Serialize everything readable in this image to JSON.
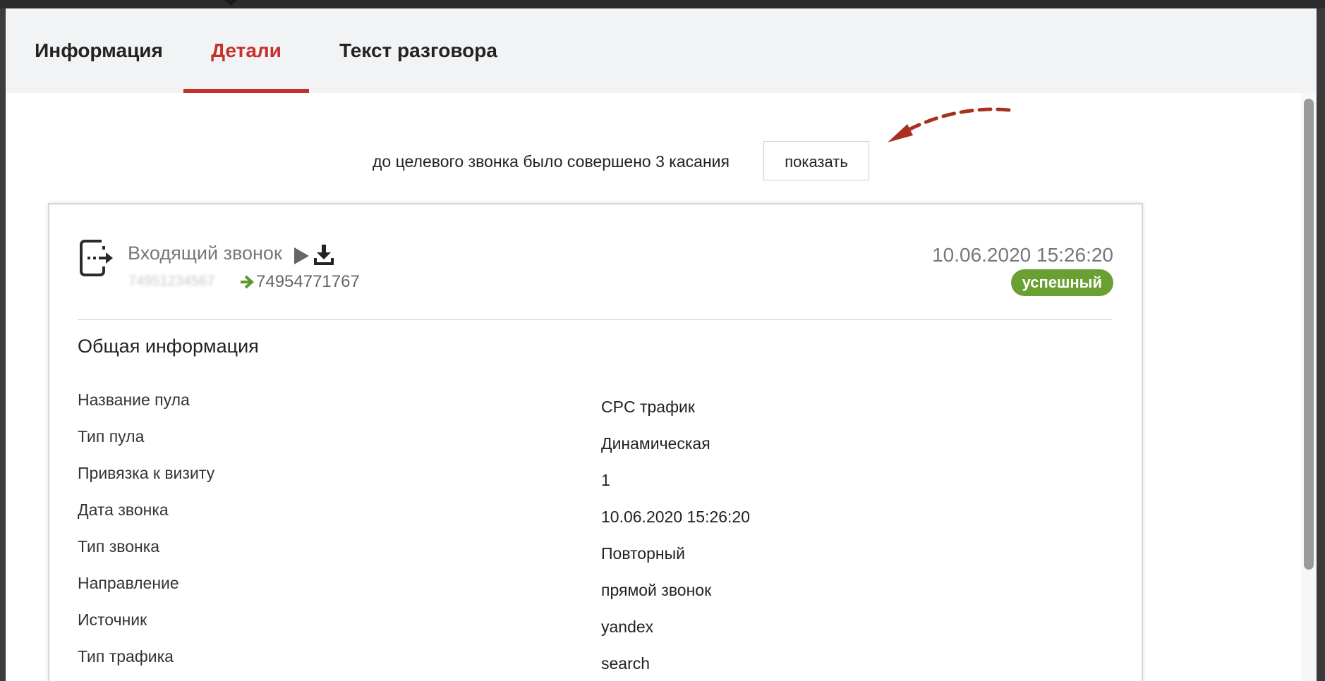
{
  "tabs": [
    {
      "label": "Информация",
      "active": false
    },
    {
      "label": "Детали",
      "active": true
    },
    {
      "label": "Текст разговора",
      "active": false
    }
  ],
  "touches": {
    "text": "до целевого звонка было совершено 3 касания",
    "button_label": "показать"
  },
  "colors": {
    "accent_red": "#c4312a",
    "status_green": "#6a9f32"
  },
  "call": {
    "icon": "call-outgoing-phone-icon",
    "title": "Входящий звонок",
    "caller_number_masked": "74951234567",
    "dest_number": "74954771767",
    "datetime": "10.06.2020 15:26:20",
    "status": "успешный"
  },
  "general": {
    "title": "Общая информация",
    "rows": [
      {
        "label": "Название пула",
        "value": "CPC трафик"
      },
      {
        "label": "Тип пула",
        "value": "Динамическая"
      },
      {
        "label": "Привязка к визиту",
        "value": "1"
      },
      {
        "label": "Дата звонка",
        "value": "10.06.2020 15:26:20"
      },
      {
        "label": "Тип звонка",
        "value": "Повторный"
      },
      {
        "label": "Направление",
        "value": "прямой звонок"
      },
      {
        "label": "Источник",
        "value": "yandex"
      },
      {
        "label": "Тип трафика",
        "value": "search"
      }
    ]
  }
}
